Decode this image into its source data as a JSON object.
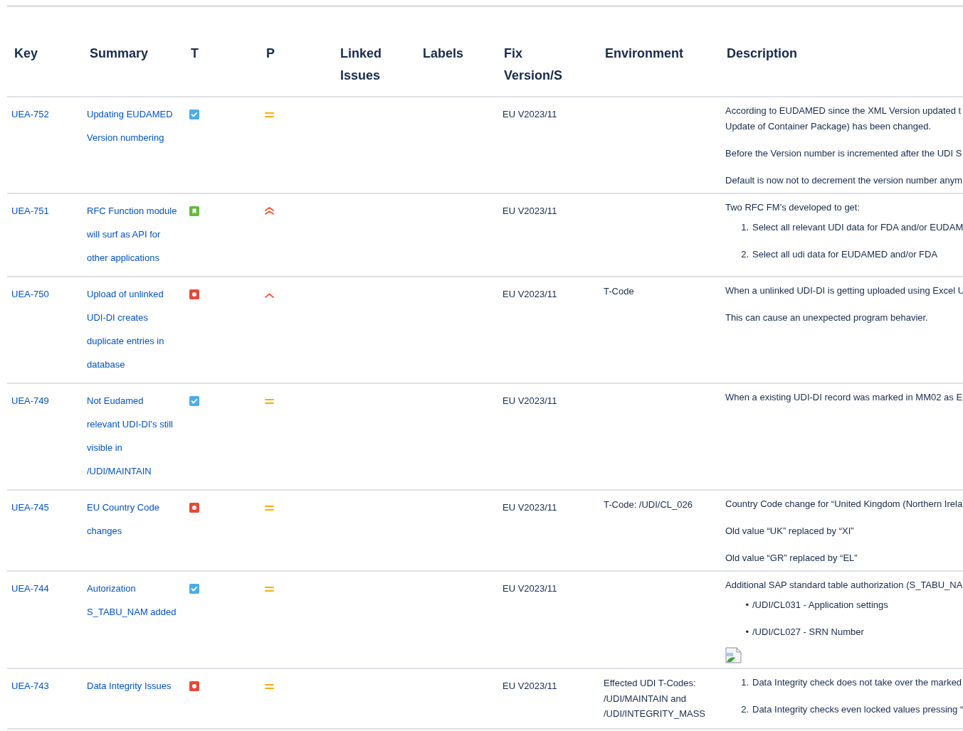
{
  "table": {
    "columns": [
      "Key",
      "Summary",
      "T",
      "P",
      "Linked Issues",
      "Labels",
      "Fix Version/S",
      "Environment",
      "Description"
    ],
    "rows": [
      {
        "key": "UEA-752",
        "summary": [
          "Updating EUDAMED",
          "Version numbering"
        ],
        "type": {
          "kind": "task"
        },
        "priority": {
          "kind": "medium"
        },
        "fix_version": "EU V2023/11",
        "description": [
          {
            "kind": "p",
            "lines": [
              "According to EUDAMED since the XML Version updated t",
              "Update of Container Package) has been changed."
            ]
          },
          {
            "kind": "p",
            "lines": [
              "Before the Version number is incremented after the UDI S"
            ]
          },
          {
            "kind": "p",
            "lines": [
              "Default is now not to decrement the version number anym"
            ]
          }
        ]
      },
      {
        "key": "UEA-751",
        "summary": [
          "RFC Function module",
          "will surf as API for",
          "other applications"
        ],
        "type": {
          "kind": "story"
        },
        "priority": {
          "kind": "highest"
        },
        "fix_version": "EU V2023/11",
        "description": [
          {
            "kind": "p",
            "lines": [
              "Two RFC FM’s developed to get:"
            ]
          },
          {
            "kind": "list",
            "items": [
              {
                "marker": "1.",
                "text": "Select all relevant UDI data for FDA and/or EUDAM"
              },
              {
                "marker": "2.",
                "text": "Select all udi data for EUDAMED and/or FDA"
              }
            ]
          }
        ]
      },
      {
        "key": "UEA-750",
        "summary": [
          "Upload of unlinked",
          "UDI-DI creates",
          "duplicate entries in",
          "database"
        ],
        "type": {
          "kind": "bug"
        },
        "priority": {
          "kind": "high"
        },
        "fix_version": "EU V2023/11",
        "environment": "T-Code",
        "description": [
          {
            "kind": "p",
            "lines": [
              "When a unlinked UDI-DI is getting uploaded using Excel U"
            ]
          },
          {
            "kind": "p",
            "lines": [
              "This can cause an unexpected program behavier."
            ]
          }
        ]
      },
      {
        "key": "UEA-749",
        "summary": [
          "Not Eudamed",
          "relevant UDI-DI's still",
          "visible in",
          "/UDI/MAINTAIN"
        ],
        "type": {
          "kind": "task"
        },
        "priority": {
          "kind": "medium"
        },
        "fix_version": "EU V2023/11",
        "description": [
          {
            "kind": "p",
            "lines": [
              "When a existing UDI-DI record was marked in MM02 as E"
            ]
          }
        ]
      },
      {
        "key": "UEA-745",
        "summary": [
          "EU Country Code",
          "changes"
        ],
        "type": {
          "kind": "bug"
        },
        "priority": {
          "kind": "medium"
        },
        "fix_version": "EU V2023/11",
        "environment": "T-Code: /UDI/CL_026",
        "description": [
          {
            "kind": "p",
            "lines": [
              "Country Code change for “United Kingdom (Northern Irela"
            ]
          },
          {
            "kind": "p",
            "lines": [
              "Old value “UK” replaced by “XI”"
            ]
          },
          {
            "kind": "p",
            "lines": [
              "Old value “GR” replaced by “EL”"
            ]
          }
        ]
      },
      {
        "key": "UEA-744",
        "summary": [
          "Autorization",
          "S_TABU_NAM added"
        ],
        "type": {
          "kind": "task"
        },
        "priority": {
          "kind": "medium"
        },
        "fix_version": "EU V2023/11",
        "description": [
          {
            "kind": "p",
            "lines": [
              "Additional SAP standard table authorization (S_TABU_NA"
            ]
          },
          {
            "kind": "list",
            "items": [
              {
                "marker": "•",
                "text": "/UDI/CL031 - Application settings"
              },
              {
                "marker": "•",
                "text": "/UDI/CL027 - SRN Number"
              }
            ]
          },
          {
            "kind": "image"
          }
        ]
      },
      {
        "key": "UEA-743",
        "summary": [
          "Data Integrity Issues"
        ],
        "type": {
          "kind": "bug"
        },
        "priority": {
          "kind": "medium"
        },
        "fix_version": "EU V2023/11",
        "environment": "Effected UDI T-Codes: /UDI/MAINTAIN and /UDI/INTEGRITY_MASS",
        "description": [
          {
            "kind": "list",
            "items": [
              {
                "marker": "1.",
                "text": "Data Integrity check does not take over the marked"
              },
              {
                "marker": "2.",
                "text": "Data Integrity checks even locked values pressing “"
              }
            ]
          }
        ]
      }
    ]
  }
}
